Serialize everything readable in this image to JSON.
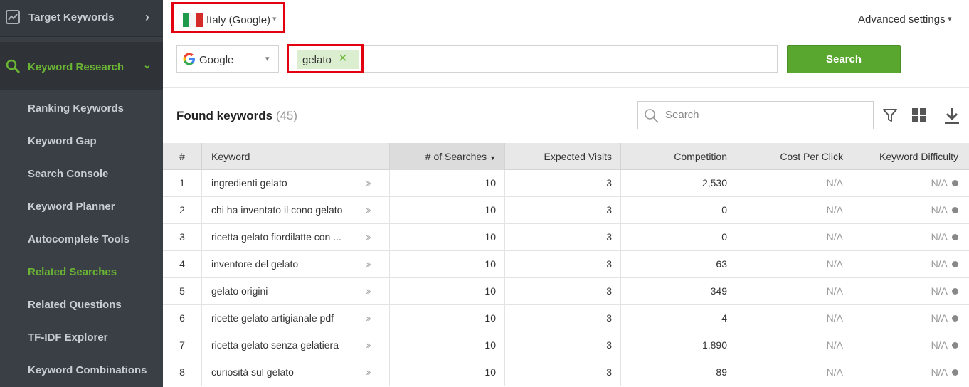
{
  "sidebar": {
    "top_item": "Target Keywords",
    "section": "Keyword Research",
    "items": [
      {
        "label": "Ranking Keywords",
        "active": false
      },
      {
        "label": "Keyword Gap",
        "active": false
      },
      {
        "label": "Search Console",
        "active": false
      },
      {
        "label": "Keyword Planner",
        "active": false
      },
      {
        "label": "Autocomplete Tools",
        "active": false
      },
      {
        "label": "Related Searches",
        "active": true
      },
      {
        "label": "Related Questions",
        "active": false
      },
      {
        "label": "TF-IDF Explorer",
        "active": false
      },
      {
        "label": "Keyword Combinations",
        "active": false
      }
    ]
  },
  "toolbar": {
    "country": "Italy (Google)",
    "advanced_settings": "Advanced settings",
    "engine": "Google",
    "keyword_tag": "gelato",
    "search_button": "Search"
  },
  "results": {
    "title": "Found keywords",
    "count": "(45)",
    "search_placeholder": "Search"
  },
  "table": {
    "columns": [
      "#",
      "Keyword",
      "# of Searches",
      "Expected Visits",
      "Competition",
      "Cost Per Click",
      "Keyword Difficulty"
    ],
    "rows": [
      {
        "num": "1",
        "keyword": "ingredienti gelato",
        "searches": "10",
        "visits": "3",
        "competition": "2,530",
        "cpc": "N/A",
        "difficulty": "N/A"
      },
      {
        "num": "2",
        "keyword": "chi ha inventato il cono gelato",
        "searches": "10",
        "visits": "3",
        "competition": "0",
        "cpc": "N/A",
        "difficulty": "N/A"
      },
      {
        "num": "3",
        "keyword": "ricetta gelato fiordilatte con ...",
        "searches": "10",
        "visits": "3",
        "competition": "0",
        "cpc": "N/A",
        "difficulty": "N/A"
      },
      {
        "num": "4",
        "keyword": "inventore del gelato",
        "searches": "10",
        "visits": "3",
        "competition": "63",
        "cpc": "N/A",
        "difficulty": "N/A"
      },
      {
        "num": "5",
        "keyword": "gelato origini",
        "searches": "10",
        "visits": "3",
        "competition": "349",
        "cpc": "N/A",
        "difficulty": "N/A"
      },
      {
        "num": "6",
        "keyword": "ricette gelato artigianale pdf",
        "searches": "10",
        "visits": "3",
        "competition": "4",
        "cpc": "N/A",
        "difficulty": "N/A"
      },
      {
        "num": "7",
        "keyword": "ricetta gelato senza gelatiera",
        "searches": "10",
        "visits": "3",
        "competition": "1,890",
        "cpc": "N/A",
        "difficulty": "N/A"
      },
      {
        "num": "8",
        "keyword": "curiosità sul gelato",
        "searches": "10",
        "visits": "3",
        "competition": "89",
        "cpc": "N/A",
        "difficulty": "N/A"
      }
    ]
  },
  "colors": {
    "accent_green": "#6ab533",
    "button_green": "#5aa72f",
    "highlight_red": "#e3000f",
    "sidebar_bg": "#3a3f45"
  }
}
